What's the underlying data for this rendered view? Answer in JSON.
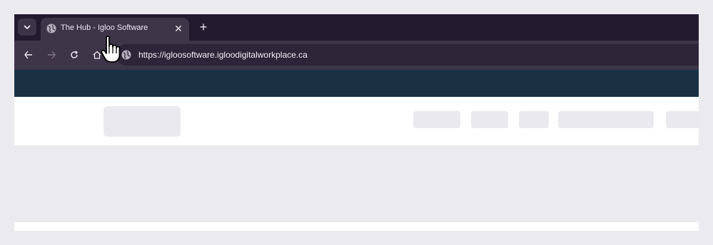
{
  "browser": {
    "tab": {
      "title": "The Hub - Igloo Software",
      "favicon": "globe-icon",
      "close_icon": "close-icon"
    },
    "new_tab_icon": "plus-icon",
    "tab_search_icon": "chevron-down-icon",
    "toolbar": {
      "back_icon": "arrow-left-icon",
      "forward_icon": "arrow-right-icon",
      "reload_icon": "reload-icon",
      "home_icon": "home-icon",
      "site_info_icon": "globe-icon",
      "url": "https://igloosoftware.igloodigitalworkplace.ca"
    }
  },
  "colors": {
    "tabstrip": "#221a2e",
    "toolbar": "#3f3548",
    "page_header": "#1a3144",
    "skeleton": "#eaeaee",
    "page_bg": "#ebebef"
  }
}
